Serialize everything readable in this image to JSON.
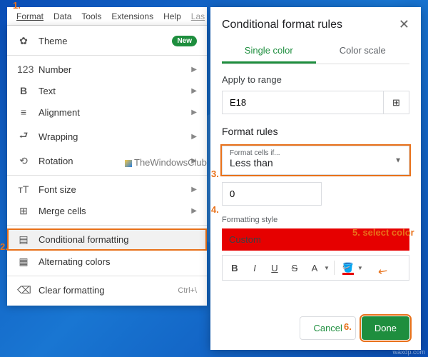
{
  "menubar": {
    "items": [
      "Format",
      "Data",
      "Tools",
      "Extensions",
      "Help"
    ],
    "last": "Las"
  },
  "dropdown": {
    "theme": "Theme",
    "badge": "New",
    "number": "Number",
    "text": "Text",
    "alignment": "Alignment",
    "wrapping": "Wrapping",
    "rotation": "Rotation",
    "fontsize": "Font size",
    "merge": "Merge cells",
    "cond": "Conditional formatting",
    "alt": "Alternating colors",
    "clear": "Clear formatting",
    "clear_short": "Ctrl+\\"
  },
  "panel": {
    "title": "Conditional format rules",
    "tab_single": "Single color",
    "tab_scale": "Color scale",
    "apply_label": "Apply to range",
    "range_value": "E18",
    "rules_label": "Format rules",
    "cells_if": "Format cells if...",
    "condition": "Less than",
    "value": "0",
    "style_label": "Formatting style",
    "style_name": "Custom",
    "cancel": "Cancel",
    "done": "Done"
  },
  "anno": {
    "a1": "1.",
    "a2": "2.",
    "a3": "3.",
    "a4": "4.",
    "a5": "5. select color",
    "a6": "6."
  },
  "watermark": "TheWindowsClub",
  "byline": "waxdp.com"
}
